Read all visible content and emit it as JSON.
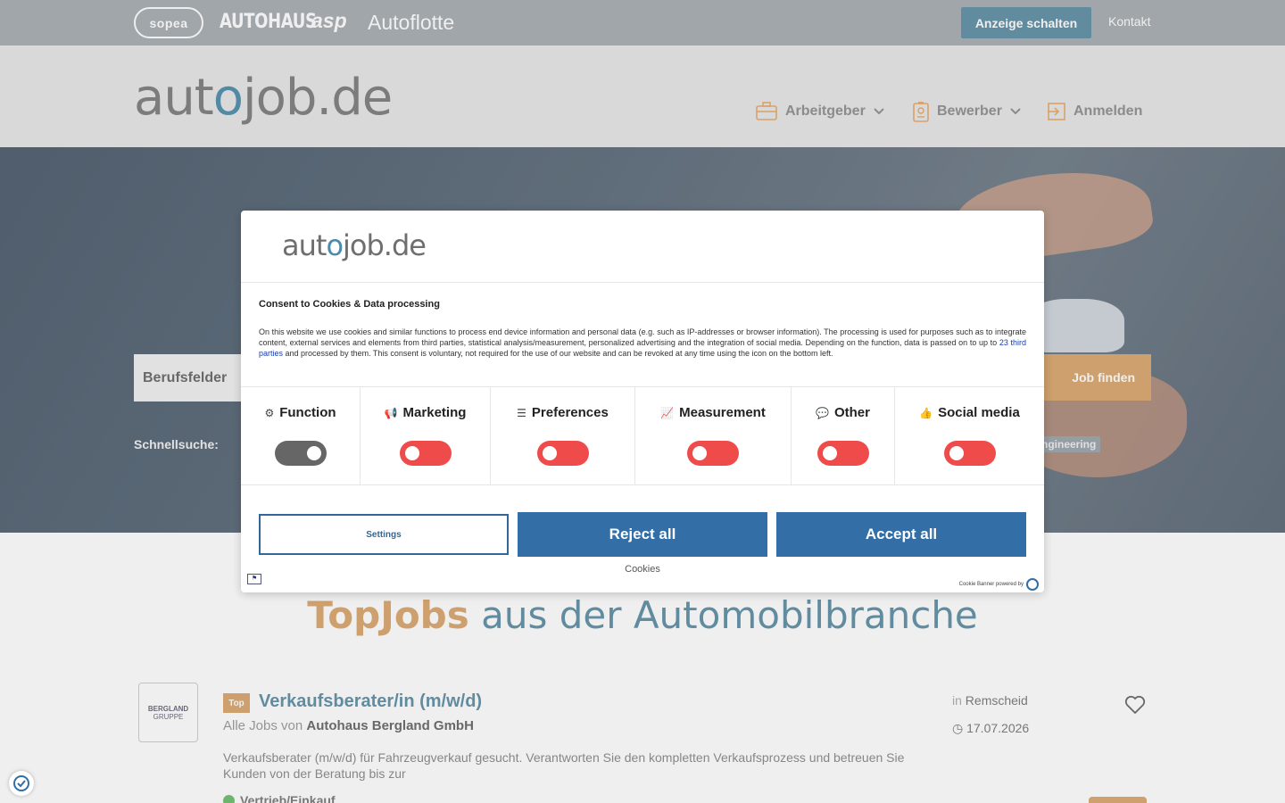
{
  "topbar": {
    "sopea": "sopea",
    "autohaus": "AUTOHAUS",
    "asp": "asp",
    "autoflotte": "Autoflotte",
    "anzeige_button": "Anzeige schalten",
    "kontakt": "Kontakt"
  },
  "header": {
    "logo_pre": "aut",
    "logo_o": "o",
    "logo_post": "job.de",
    "nav": {
      "arbeitgeber": "Arbeitgeber",
      "bewerber": "Bewerber",
      "anmelden": "Anmelden"
    }
  },
  "hero": {
    "search_placeholder": "Berufsfelder",
    "job_button": "Job finden",
    "schnellsuche": "Schnellsuche:",
    "tag": "ngineering"
  },
  "content": {
    "topjobs_a": "TopJobs",
    "topjobs_b": "aus der Automobilbranche",
    "job": {
      "logo_line1": "BERGLAND",
      "logo_line2": "GRUPPE",
      "badge": "Top",
      "title": "Verkaufsberater/in (m/w/d)",
      "sub_prefix": "Alle Jobs",
      "sub_von": "von",
      "company": "Autohaus Bergland GmbH",
      "location_prefix": "in",
      "location": "Remscheid",
      "date": "17.07.2026",
      "description": "Verkaufsberater (m/w/d) für Fahrzeugverkauf gesucht. Verantworten Sie den kompletten Verkaufsprozess und betreuen Sie Kunden von der Beratung bis zur",
      "category": "Vertrieb/Einkauf"
    }
  },
  "cookie": {
    "logo_pre": "aut",
    "logo_o": "o",
    "logo_post": "job.de",
    "heading": "Consent to Cookies & Data processing",
    "text_1": "On this website we use cookies and similar functions to process end device information and personal data (e.g. such as IP-addresses or browser information). The processing is used for purposes such as to integrate content, external services and elements from third parties, statistical analysis/measurement, personalized advertising and the integration of social media. Depending on the function, data is passed on to up to ",
    "third_parties_link": "23 third parties",
    "text_2": " and processed by them. This consent is voluntary, not required for the use of our website and can be revoked at any time using the icon on the bottom left.",
    "categories": [
      {
        "label": "Function",
        "icon": "function-icon",
        "glyph": "⚙",
        "state": "on"
      },
      {
        "label": "Marketing",
        "icon": "megaphone-icon",
        "glyph": "📢",
        "state": "off"
      },
      {
        "label": "Preferences",
        "icon": "sliders-icon",
        "glyph": "☰",
        "state": "off"
      },
      {
        "label": "Measurement",
        "icon": "chart-line-icon",
        "glyph": "📈",
        "state": "off"
      },
      {
        "label": "Other",
        "icon": "chat-icon",
        "glyph": "💬",
        "state": "off"
      },
      {
        "label": "Social media",
        "icon": "thumbs-up-icon",
        "glyph": "👍",
        "state": "off"
      }
    ],
    "settings_button": "Settings",
    "reject_button": "Reject all",
    "accept_button": "Accept all",
    "cookies_link": "Cookies",
    "powered_by": "Cookie Banner powered by"
  },
  "colors": {
    "brand_blue": "#5e8fa6",
    "brand_orange": "#d9a56c",
    "consent_blue": "#336ea6",
    "toggle_off": "#ef4b4b"
  }
}
